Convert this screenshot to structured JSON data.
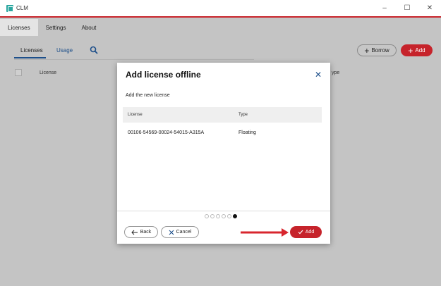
{
  "window": {
    "title": "CLM",
    "controls": [
      "–",
      "☐",
      "✕"
    ]
  },
  "menu": {
    "tabs": [
      {
        "label": "Licenses"
      },
      {
        "label": "Settings"
      },
      {
        "label": "About"
      }
    ]
  },
  "subnav": {
    "tabs": [
      {
        "label": "Licenses"
      },
      {
        "label": "Usage"
      }
    ]
  },
  "actions": {
    "borrow_label": "Borrow",
    "add_label": "Add"
  },
  "list": {
    "col_license": "License",
    "col_type": "ype"
  },
  "dialog": {
    "title": "Add license offline",
    "close": "✕",
    "subtitle": "Add the new license",
    "columns": {
      "license": "License",
      "type": "Type"
    },
    "rows": [
      {
        "license": "00106-54569-00024-54015-A315A",
        "type": "Floating"
      }
    ],
    "steps_total": 6,
    "steps_current": 6,
    "back_label": "Back",
    "cancel_label": "Cancel",
    "add_label": "Add"
  },
  "colors": {
    "accent_red": "#c6232b",
    "accent_blue": "#1d4f8a",
    "brand_teal": "#2aa7a0"
  }
}
